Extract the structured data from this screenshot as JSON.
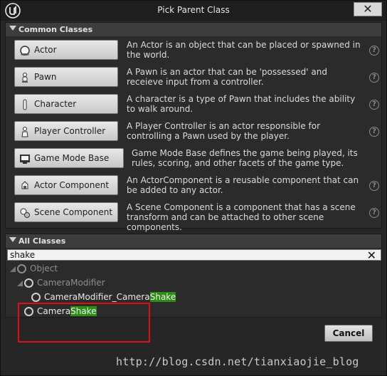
{
  "window": {
    "title": "Pick Parent Class",
    "close_label": "✕"
  },
  "common": {
    "header": "Common Classes",
    "classes": [
      {
        "label": "Actor",
        "desc": "An Actor is an object that can be placed or spawned in the world."
      },
      {
        "label": "Pawn",
        "desc": "A Pawn is an actor that can be 'possessed' and receieve input from a controller."
      },
      {
        "label": "Character",
        "desc": "A character is a type of Pawn that includes the ability to walk around."
      },
      {
        "label": "Player Controller",
        "desc": "A Player Controller is an actor responsible for controlling a Pawn used by the player."
      },
      {
        "label": "Game Mode Base",
        "desc": "Game Mode Base defines the game being played, its rules, scoring, and other facets of the game type."
      },
      {
        "label": "Actor Component",
        "desc": "An ActorComponent is a reusable component that can be added to any actor."
      },
      {
        "label": "Scene Component",
        "desc": "A Scene Component is a component that has a scene transform and can be attached to other scene components."
      }
    ],
    "help_glyph": "?"
  },
  "all": {
    "header": "All Classes",
    "search_value": "shake",
    "clear_glyph": "✕",
    "tree": {
      "root": "Object",
      "level1": "CameraModifier",
      "level2_prefix": "CameraModifier_Camera",
      "level2_match": "Shake",
      "level3_prefix": "Camera",
      "level3_match": "Shake"
    }
  },
  "footer": {
    "cancel_label": "Cancel",
    "watermark": "http://blog.csdn.net/tianxiaojie_blog"
  }
}
